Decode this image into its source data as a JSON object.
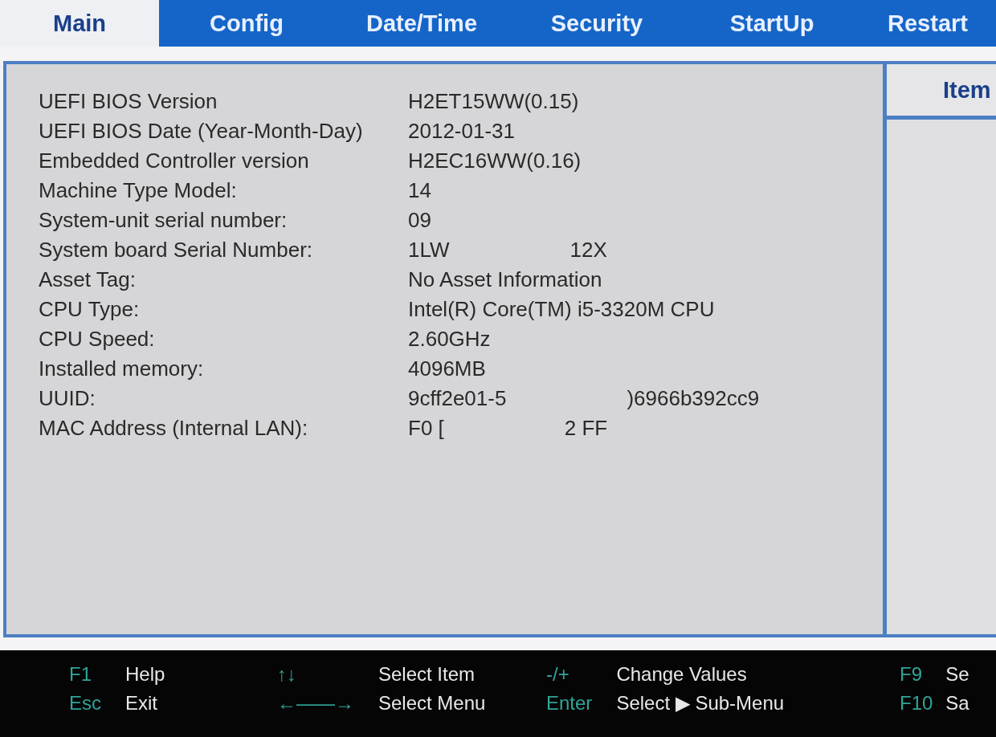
{
  "tabs": [
    {
      "label": "Main",
      "selected": true
    },
    {
      "label": "Config",
      "selected": false
    },
    {
      "label": "Date/Time",
      "selected": false
    },
    {
      "label": "Security",
      "selected": false
    },
    {
      "label": "StartUp",
      "selected": false
    },
    {
      "label": "Restart",
      "selected": false
    }
  ],
  "info": [
    {
      "label": "UEFI BIOS Version",
      "value": [
        "H2ET15WW(0.15)"
      ]
    },
    {
      "label": "UEFI BIOS Date (Year-Month-Day)",
      "value": [
        "2012-01-31"
      ]
    },
    {
      "label": "Embedded Controller version",
      "value": [
        "H2EC16WW(0.16)"
      ]
    },
    {
      "label": "Machine Type Model:",
      "value": [
        "14"
      ]
    },
    {
      "label": "System-unit serial number:",
      "value": [
        "09"
      ]
    },
    {
      "label": "System board Serial Number:",
      "value": [
        "1LW",
        "12X"
      ]
    },
    {
      "label": "Asset Tag:",
      "value": [
        "No Asset Information"
      ]
    },
    {
      "label": "CPU Type:",
      "value": [
        "Intel(R) Core(TM) i5-3320M CPU"
      ]
    },
    {
      "label": "CPU Speed:",
      "value": [
        "2.60GHz"
      ]
    },
    {
      "label": "Installed memory:",
      "value": [
        "4096MB"
      ]
    },
    {
      "label": "UUID:",
      "value": [
        "9cff2e01-5",
        ")6966b392cc9"
      ]
    },
    {
      "label": "MAC Address (Internal LAN):",
      "value": [
        "F0 [",
        "2 FF"
      ]
    }
  ],
  "help_panel": {
    "title": "Item"
  },
  "footer": [
    {
      "key": "F1",
      "action": "Help",
      "key2": "Esc",
      "action2": "Exit"
    },
    {
      "key": "↑↓",
      "action": "Select Item",
      "key2": "←——→",
      "action2": "Select Menu"
    },
    {
      "key": "-/+",
      "action": "Change Values",
      "key2": "Enter",
      "action2": "Select ▶ Sub-Menu"
    },
    {
      "key": "F9",
      "action": "Se",
      "key2": "F10",
      "action2": "Sa"
    }
  ]
}
